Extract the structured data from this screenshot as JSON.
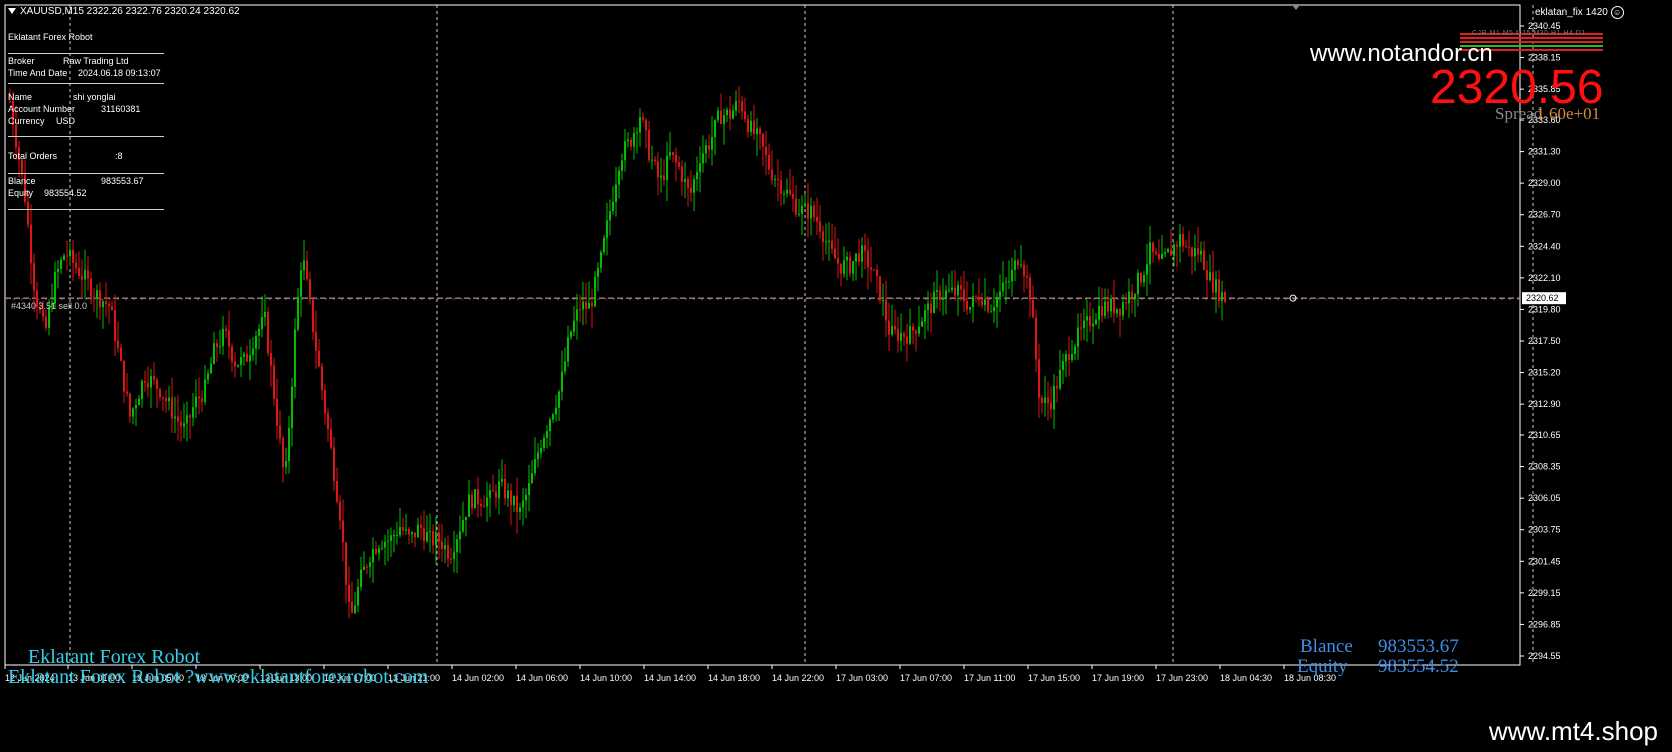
{
  "window": {
    "symbol_line": "XAUUSD,M15  2322.26 2322.76 2320.24 2320.62",
    "ea_name": "eklatan_fix 1420",
    "smiley": "☺",
    "watermark": "www.notandor.cn",
    "big_price": "2320.56",
    "spread_label": "Spread",
    "spread_value": "1.60e+01",
    "timeframes": "CJR  M1  M5 M15 M30  H1  H4  D1",
    "order_label": "#4340 3.51 sell 0.0",
    "robot_name": "Eklatant Forex Robot",
    "robot_url_line": "Eklatant Forex Robot ?www.eklatantforexrobot.com",
    "balance_label": "Blance",
    "balance_value": "983553.67",
    "equity_label": "Equity",
    "equity_value": "983554.52"
  },
  "info_panel": {
    "title": "Eklatant Forex Robot",
    "broker_label": "Broker",
    "broker_value": "Raw Trading Ltd",
    "time_label": "Time And Date",
    "time_value": "2024.06.18 09:13:07",
    "name_label": "Name",
    "name_value": "shi yonglai",
    "account_label": "Account Number",
    "account_value": "31160381",
    "currency_label": "Currency",
    "currency_value": "USD",
    "orders_label": "Total Orders",
    "orders_value": ":8",
    "balance_label": "Blance",
    "balance_value": "983553.67",
    "equity_label": "Equity",
    "equity_value": "983554.52"
  },
  "footer": {
    "text": "www.mt4.shop"
  },
  "chart_data": {
    "type": "candlestick",
    "symbol": "XAUUSD",
    "timeframe": "M15",
    "current_price": 2320.62,
    "ylim": [
      2294.55,
      2340.45
    ],
    "y_ticks": [
      "2340.45",
      "2338.15",
      "2335.85",
      "2333.60",
      "2331.30",
      "2329.00",
      "2326.70",
      "2324.40",
      "2322.10",
      "2319.80",
      "2317.50",
      "2315.20",
      "2312.90",
      "2310.65",
      "2308.35",
      "2306.05",
      "2303.75",
      "2301.45",
      "2299.15",
      "2296.85",
      "2294.55"
    ],
    "x_ticks": [
      "12 Jun 2024",
      "13 Jun 01:00",
      "13 Jun 05:00",
      "13 Jun 09:00",
      "13 Jun 13:00",
      "13 Jun 17:00",
      "13 Jun 21:00",
      "14 Jun 02:00",
      "14 Jun 06:00",
      "14 Jun 10:00",
      "14 Jun 14:00",
      "14 Jun 18:00",
      "14 Jun 22:00",
      "17 Jun 03:00",
      "17 Jun 07:00",
      "17 Jun 11:00",
      "17 Jun 15:00",
      "17 Jun 19:00",
      "17 Jun 23:00",
      "18 Jun 04:30",
      "18 Jun 08:30"
    ],
    "price_anchors": [
      [
        0,
        2335
      ],
      [
        15,
        2328
      ],
      [
        25,
        2321
      ],
      [
        35,
        2318
      ],
      [
        45,
        2322
      ],
      [
        55,
        2324
      ],
      [
        65,
        2323
      ],
      [
        75,
        2322
      ],
      [
        85,
        2321
      ],
      [
        100,
        2320
      ],
      [
        110,
        2316
      ],
      [
        120,
        2312
      ],
      [
        135,
        2315
      ],
      [
        150,
        2314
      ],
      [
        165,
        2312
      ],
      [
        175,
        2311
      ],
      [
        185,
        2313
      ],
      [
        195,
        2314
      ],
      [
        205,
        2317
      ],
      [
        215,
        2318
      ],
      [
        225,
        2316
      ],
      [
        235,
        2316
      ],
      [
        245,
        2318
      ],
      [
        255,
        2319
      ],
      [
        265,
        2313
      ],
      [
        275,
        2307
      ],
      [
        285,
        2318
      ],
      [
        292,
        2324
      ],
      [
        300,
        2320
      ],
      [
        310,
        2315
      ],
      [
        320,
        2310
      ],
      [
        330,
        2305
      ],
      [
        340,
        2297
      ],
      [
        350,
        2300
      ],
      [
        360,
        2302
      ],
      [
        370,
        2303
      ],
      [
        380,
        2303
      ],
      [
        390,
        2304
      ],
      [
        400,
        2303
      ],
      [
        410,
        2304
      ],
      [
        420,
        2303
      ],
      [
        430,
        2303
      ],
      [
        440,
        2302
      ],
      [
        450,
        2304
      ],
      [
        460,
        2306
      ],
      [
        470,
        2306
      ],
      [
        480,
        2306
      ],
      [
        490,
        2307
      ],
      [
        500,
        2306
      ],
      [
        510,
        2305
      ],
      [
        520,
        2307
      ],
      [
        530,
        2310
      ],
      [
        540,
        2312
      ],
      [
        550,
        2314
      ],
      [
        560,
        2318
      ],
      [
        570,
        2320
      ],
      [
        580,
        2320
      ],
      [
        590,
        2323
      ],
      [
        600,
        2327
      ],
      [
        610,
        2331
      ],
      [
        620,
        2332
      ],
      [
        630,
        2334
      ],
      [
        640,
        2331
      ],
      [
        650,
        2329
      ],
      [
        660,
        2331
      ],
      [
        670,
        2330
      ],
      [
        680,
        2328
      ],
      [
        690,
        2331
      ],
      [
        700,
        2332
      ],
      [
        710,
        2334
      ],
      [
        720,
        2334
      ],
      [
        730,
        2335
      ],
      [
        740,
        2333
      ],
      [
        750,
        2332
      ],
      [
        760,
        2330
      ],
      [
        770,
        2329
      ],
      [
        780,
        2328
      ],
      [
        790,
        2327
      ],
      [
        800,
        2327
      ],
      [
        810,
        2326
      ],
      [
        820,
        2324
      ],
      [
        830,
        2323
      ],
      [
        840,
        2323
      ],
      [
        850,
        2324
      ],
      [
        860,
        2323
      ],
      [
        870,
        2321
      ],
      [
        880,
        2318
      ],
      [
        890,
        2318
      ],
      [
        900,
        2318
      ],
      [
        910,
        2319
      ],
      [
        920,
        2320
      ],
      [
        930,
        2321
      ],
      [
        940,
        2321
      ],
      [
        950,
        2321
      ],
      [
        960,
        2320
      ],
      [
        970,
        2321
      ],
      [
        980,
        2320
      ],
      [
        990,
        2321
      ],
      [
        1000,
        2322
      ],
      [
        1010,
        2324
      ],
      [
        1020,
        2321
      ],
      [
        1030,
        2313
      ],
      [
        1040,
        2313
      ],
      [
        1050,
        2315
      ],
      [
        1060,
        2317
      ],
      [
        1070,
        2318
      ],
      [
        1080,
        2319
      ],
      [
        1090,
        2320
      ],
      [
        1100,
        2320
      ],
      [
        1110,
        2320
      ],
      [
        1120,
        2321
      ],
      [
        1130,
        2322
      ],
      [
        1140,
        2324
      ],
      [
        1150,
        2323
      ],
      [
        1160,
        2324
      ],
      [
        1170,
        2325
      ],
      [
        1180,
        2324
      ],
      [
        1190,
        2324
      ],
      [
        1200,
        2322
      ],
      [
        1210,
        2321
      ],
      [
        1215,
        2320.62
      ]
    ]
  },
  "colors": {
    "up": "#00c000",
    "down": "#e01515",
    "grid": "#ffffff",
    "axis": "#ffffff",
    "price_line": "#c0c0c0"
  }
}
